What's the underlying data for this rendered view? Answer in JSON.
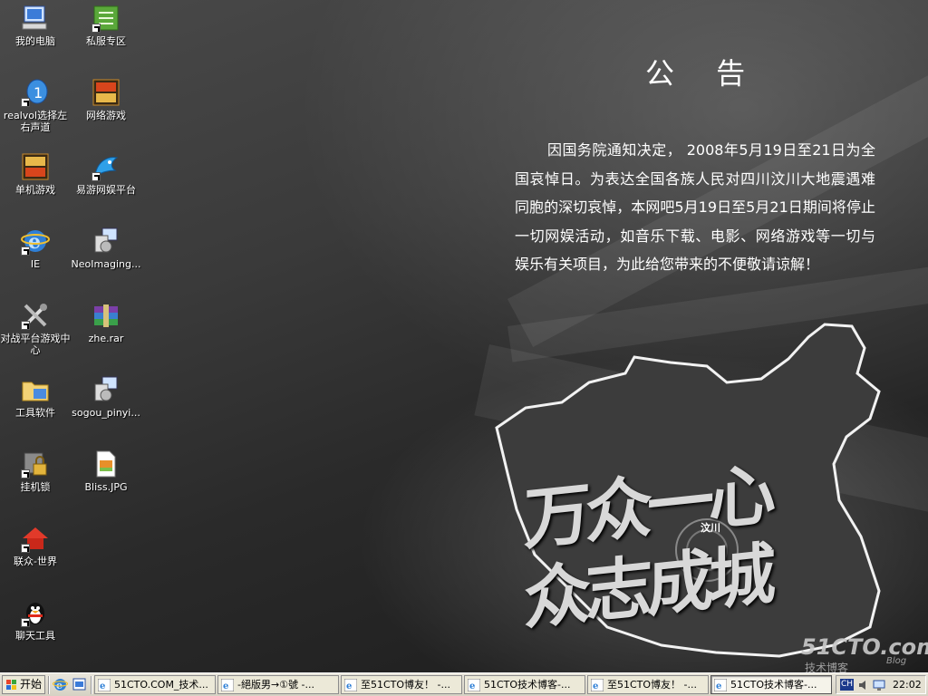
{
  "desktop_icons": [
    {
      "label": "我的电脑",
      "icon": "my-computer-icon"
    },
    {
      "label": "私服专区",
      "icon": "private-server-icon"
    },
    {
      "label": "realvol选择左右声道",
      "icon": "realvol-icon"
    },
    {
      "label": "网络游戏",
      "icon": "online-games-icon"
    },
    {
      "label": "单机游戏",
      "icon": "single-games-icon"
    },
    {
      "label": "易游网娱平台",
      "icon": "yiyou-platform-icon"
    },
    {
      "label": "IE",
      "icon": "ie-icon"
    },
    {
      "label": "NeoImaging...",
      "icon": "installer-icon"
    },
    {
      "label": "对战平台游戏中心",
      "icon": "tools-icon"
    },
    {
      "label": "zhe.rar",
      "icon": "rar-archive-icon"
    },
    {
      "label": "工具软件",
      "icon": "folder-icon"
    },
    {
      "label": "sogou_pinyi...",
      "icon": "installer-icon"
    },
    {
      "label": "挂机锁",
      "icon": "lock-icon"
    },
    {
      "label": "Bliss.JPG",
      "icon": "jpg-file-icon"
    },
    {
      "label": "联众-世界",
      "icon": "house-icon"
    },
    {
      "label": "聊天工具",
      "icon": "qq-penguin-icon"
    }
  ],
  "notice": {
    "title": "公 告",
    "body": "因国务院通知决定， 2008年5月19日至21日为全国哀悼日。为表达全国各族人民对四川汶川大地震遇难同胞的深切哀悼，本网吧5月19日至5月21日期间将停止一切网娱活动，如音乐下载、电影、网络游戏等一切与娱乐有关项目，为此给您带来的不便敬请谅解！"
  },
  "wallpaper": {
    "slogan_line1": "万众一心",
    "slogan_line2": "众志成城",
    "place_label": "汶川",
    "watermark": "51CTO.com",
    "watermark_sub": "技术博客",
    "watermark_blog": "Blog"
  },
  "taskbar": {
    "start_label": "开始",
    "buttons": [
      {
        "label": "51CTO.COM_技术..."
      },
      {
        "label": "-絕版男→①號 -..."
      },
      {
        "label": "至51CTO博友！ -..."
      },
      {
        "label": "51CTO技术博客-..."
      },
      {
        "label": "至51CTO博友！ -..."
      },
      {
        "label": "51CTO技术博客-..."
      }
    ],
    "active_index": 5,
    "tray": {
      "ime": "CH",
      "clock": "22:02"
    }
  }
}
